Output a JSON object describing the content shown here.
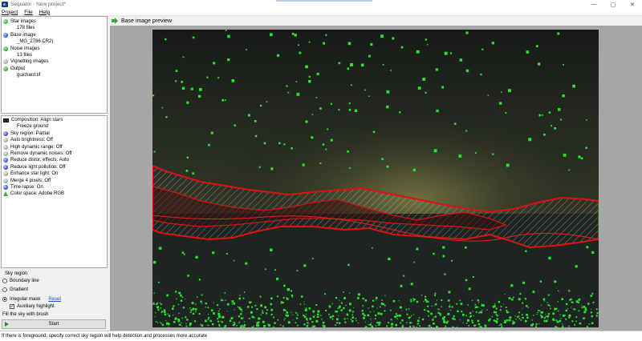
{
  "window": {
    "title": "Sequator - New project*",
    "minimize": "—",
    "maximize": "▢",
    "close": "✕"
  },
  "menu": [
    "Project",
    "File",
    "Help"
  ],
  "tree": [
    {
      "icon": "green",
      "label": "Star images",
      "indent": false
    },
    {
      "icon": "none",
      "label": "178 files",
      "indent": true
    },
    {
      "icon": "blue",
      "label": "Base image",
      "indent": false
    },
    {
      "icon": "none",
      "label": "_MG_2786.CR2)",
      "indent": true
    },
    {
      "icon": "green",
      "label": "Noise images",
      "indent": false
    },
    {
      "icon": "none",
      "label": "13 files",
      "indent": true
    },
    {
      "icon": "gray",
      "label": "Vignetting images",
      "indent": false
    },
    {
      "icon": "green",
      "label": "Output",
      "indent": false
    },
    {
      "icon": "none",
      "label": "guichard.tif",
      "indent": true
    }
  ],
  "settings": [
    {
      "icon": "monitor",
      "label": "Composition: Align stars"
    },
    {
      "icon": "none",
      "label": "Freeze ground",
      "indent": true
    },
    {
      "icon": "blue",
      "label": "Sky region: Partial"
    },
    {
      "icon": "gray",
      "label": "Auto brightness: Off"
    },
    {
      "icon": "gray",
      "label": "High dynamic range: Off"
    },
    {
      "icon": "gray",
      "label": "Remove dynamic noises: Off"
    },
    {
      "icon": "blue",
      "label": "Reduce distor. effects: Auto"
    },
    {
      "icon": "blue",
      "label": "Reduce light pollution: Off"
    },
    {
      "icon": "gray",
      "label": "Enhance star light: On"
    },
    {
      "icon": "gray",
      "label": "Merge 4 pixels: Off"
    },
    {
      "icon": "blue",
      "label": "Time-lapse: On"
    },
    {
      "icon": "tri",
      "label": "Color space: Adobe RGB"
    }
  ],
  "sky_region": {
    "title": "Sky region",
    "boundary_line": "Boundary line",
    "gradient": "Gradient",
    "irregular_mask": "Irregular mask",
    "reset": "Reset",
    "auxiliary_highlight": "Auxiliary highlight",
    "hint": "Fill the sky with brush",
    "selected": "irregular_mask",
    "auxiliary_checked": true
  },
  "start_button": "Start",
  "preview": {
    "title": "Base image preview"
  },
  "status": "If there is foreground, specify correct sky region will help detection and processes more accurate",
  "colors": {
    "mask_red": "#e01010",
    "star_green": "#27e32a",
    "sky_dark": "#1b1f1a"
  }
}
